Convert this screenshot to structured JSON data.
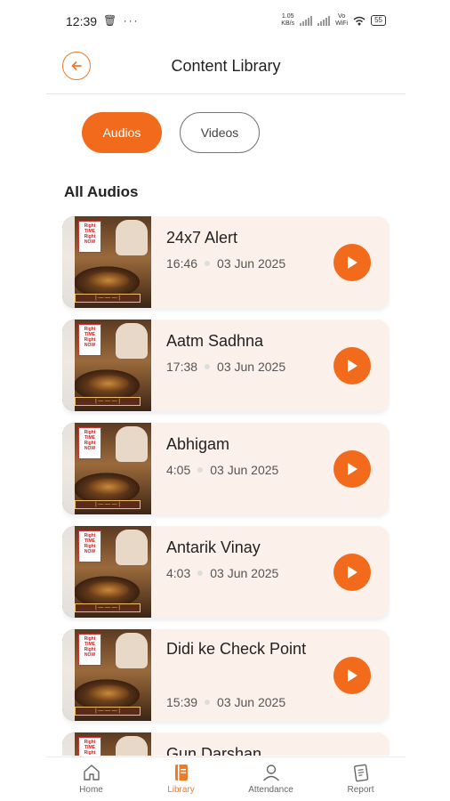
{
  "status_bar": {
    "time": "12:39",
    "left_icons": "🗑 ···",
    "net_speed_top": "1.05",
    "net_speed_bottom": "KB/s",
    "volte_top": "Vo",
    "volte_bottom": "WiFi",
    "battery": "55"
  },
  "header": {
    "title": "Content Library",
    "back_icon": "back-arrow-icon"
  },
  "tabs": [
    {
      "label": "Audios",
      "active": true
    },
    {
      "label": "Videos",
      "active": false
    }
  ],
  "section_title": "All Audios",
  "audios": [
    {
      "title": "24x7 Alert",
      "duration": "16:46",
      "date": "03 Jun 2025"
    },
    {
      "title": "Aatm Sadhna",
      "duration": "17:38",
      "date": "03 Jun 2025"
    },
    {
      "title": "Abhigam",
      "duration": "4:05",
      "date": "03 Jun 2025"
    },
    {
      "title": "Antarik Vinay",
      "duration": "4:03",
      "date": "03 Jun 2025"
    },
    {
      "title": "Didi ke Check Point",
      "duration": "15:39",
      "date": "03 Jun 2025"
    },
    {
      "title": "Gun Darshan",
      "duration": "",
      "date": ""
    }
  ],
  "bottom_nav": [
    {
      "label": "Home",
      "icon": "home-icon",
      "active": false
    },
    {
      "label": "Library",
      "icon": "library-icon",
      "active": true
    },
    {
      "label": "Attendance",
      "icon": "user-icon",
      "active": false
    },
    {
      "label": "Report",
      "icon": "report-icon",
      "active": false
    }
  ],
  "colors": {
    "accent": "#f26a1b",
    "card_bg": "#fcf1ea"
  }
}
